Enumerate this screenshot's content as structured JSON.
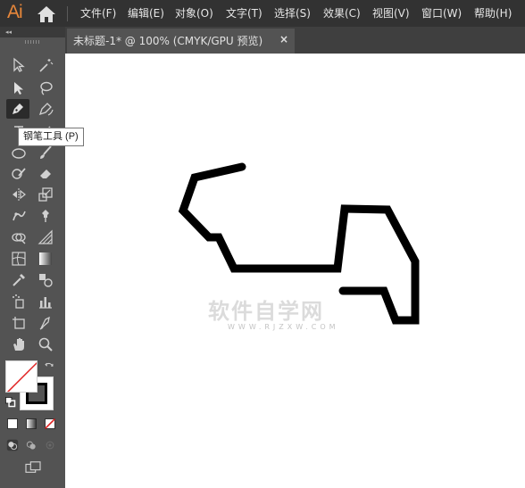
{
  "app": {
    "logo": "Ai",
    "menu": [
      "文件(F)",
      "编辑(E)",
      "对象(O)",
      "文字(T)",
      "选择(S)",
      "效果(C)",
      "视图(V)",
      "窗口(W)",
      "帮助(H)"
    ]
  },
  "document_tab": {
    "title": "未标题-1* @ 100% (CMYK/GPU 预览)",
    "close": "×"
  },
  "tooltip": {
    "text": "钢笔工具 (P)"
  },
  "tools": [
    {
      "name": "selection-tool-icon"
    },
    {
      "name": "magic-wand-tool-icon"
    },
    {
      "name": "direct-selection-tool-icon"
    },
    {
      "name": "lasso-tool-icon"
    },
    {
      "name": "pen-tool-icon",
      "active": true
    },
    {
      "name": "curvature-tool-icon"
    },
    {
      "name": "type-tool-icon"
    },
    {
      "name": "line-segment-tool-icon"
    },
    {
      "name": "ellipse-tool-icon"
    },
    {
      "name": "paintbrush-tool-icon"
    },
    {
      "name": "shaper-tool-icon"
    },
    {
      "name": "eraser-tool-icon"
    },
    {
      "name": "reflect-tool-icon"
    },
    {
      "name": "scale-tool-icon"
    },
    {
      "name": "puppet-warp-tool-icon"
    },
    {
      "name": "pin-tool-icon"
    },
    {
      "name": "shape-builder-tool-icon"
    },
    {
      "name": "perspective-grid-tool-icon"
    },
    {
      "name": "mesh-tool-icon"
    },
    {
      "name": "gradient-tool-icon"
    },
    {
      "name": "eyedropper-tool-icon"
    },
    {
      "name": "blend-tool-icon"
    },
    {
      "name": "symbol-sprayer-tool-icon"
    },
    {
      "name": "column-graph-tool-icon"
    },
    {
      "name": "artboard-tool-icon"
    },
    {
      "name": "slice-tool-icon"
    },
    {
      "name": "hand-tool-icon"
    },
    {
      "name": "zoom-tool-icon"
    }
  ],
  "colors": {
    "fill": "#ffffff",
    "stroke": "#000000",
    "accent": "#e8873a"
  },
  "watermark": {
    "cn": "软件自学网",
    "en": "WWW.RJZXW.COM"
  }
}
